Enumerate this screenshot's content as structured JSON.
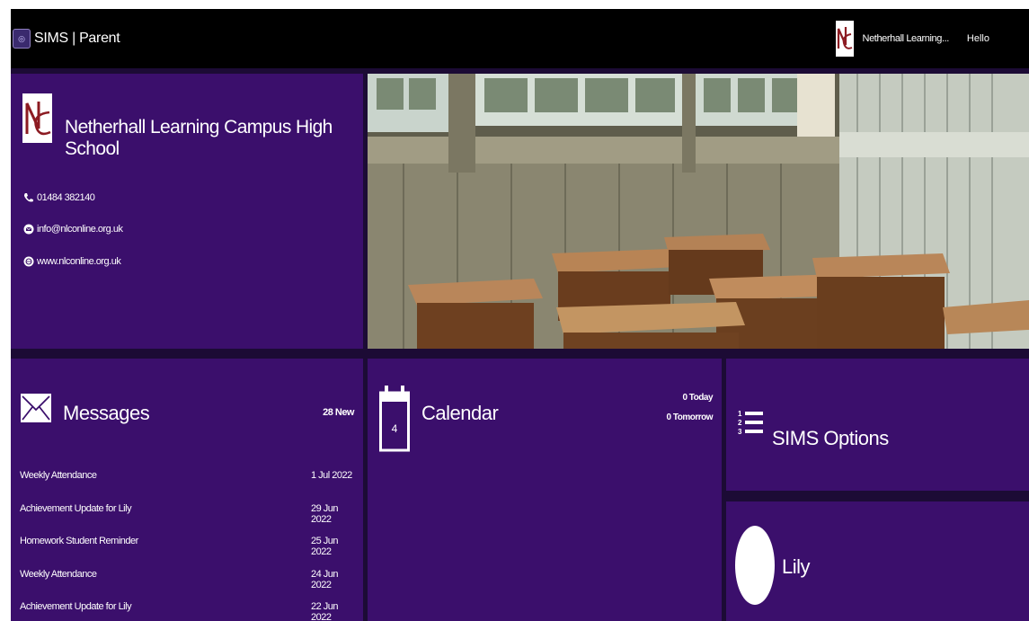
{
  "header": {
    "app_title": "SIMS | Parent",
    "school_short": "Netherhall Learning...",
    "greeting": "Hello"
  },
  "school": {
    "name": "Netherhall Learning Campus High School",
    "crest_letters": "NC",
    "phone": "01484 382140",
    "email": "info@nlconline.org.uk",
    "website": "www.nlconline.org.uk"
  },
  "messages": {
    "title": "Messages",
    "count_label": "28 New",
    "items": [
      {
        "subject": "Weekly Attendance",
        "date": "1 Jul 2022"
      },
      {
        "subject": "Achievement Update for Lily",
        "date": "29 Jun 2022"
      },
      {
        "subject": "Homework Student Reminder",
        "date": "25 Jun 2022"
      },
      {
        "subject": "Weekly Attendance",
        "date": "24 Jun 2022"
      },
      {
        "subject": "Achievement Update for Lily",
        "date": "22 Jun 2022"
      }
    ]
  },
  "calendar": {
    "title": "Calendar",
    "icon_day": "4",
    "today_label": "0 Today",
    "tomorrow_label": "0 Tomorrow"
  },
  "options": {
    "title": "SIMS Options"
  },
  "child": {
    "name": "Lily"
  },
  "colors": {
    "tile_purple": "#3b0f6c",
    "topbar": "#000000",
    "crest_red": "#8c1b22"
  }
}
